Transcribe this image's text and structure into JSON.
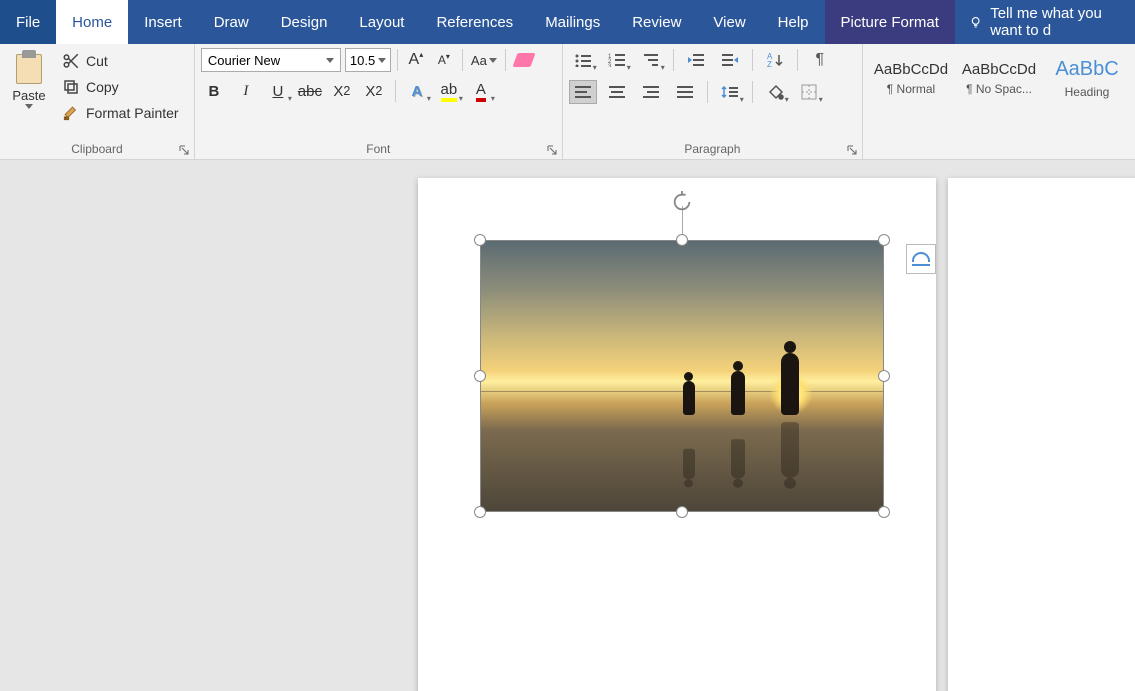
{
  "tabs": {
    "file": "File",
    "home": "Home",
    "insert": "Insert",
    "draw": "Draw",
    "design": "Design",
    "layout": "Layout",
    "references": "References",
    "mailings": "Mailings",
    "review": "Review",
    "view": "View",
    "help": "Help",
    "picture_format": "Picture Format"
  },
  "tellme_placeholder": "Tell me what you want to d",
  "clipboard": {
    "paste": "Paste",
    "cut": "Cut",
    "copy": "Copy",
    "format_painter": "Format Painter",
    "group_label": "Clipboard"
  },
  "font": {
    "name": "Courier New",
    "size": "10.5",
    "increase": "A",
    "decrease": "A",
    "change_case": "Aa",
    "bold": "B",
    "italic": "I",
    "underline": "U",
    "strike": "abc",
    "subscript": "X",
    "subscript_sub": "2",
    "superscript": "X",
    "superscript_sup": "2",
    "text_effects": "A",
    "highlight": "ab",
    "font_color": "A",
    "group_label": "Font"
  },
  "paragraph": {
    "pilcrow": "¶",
    "group_label": "Paragraph"
  },
  "styles": {
    "sample": "AaBbCcDd",
    "sample_heading": "AaBbC",
    "normal": "¶ Normal",
    "no_spacing": "¶ No Spac...",
    "heading": "Heading"
  }
}
